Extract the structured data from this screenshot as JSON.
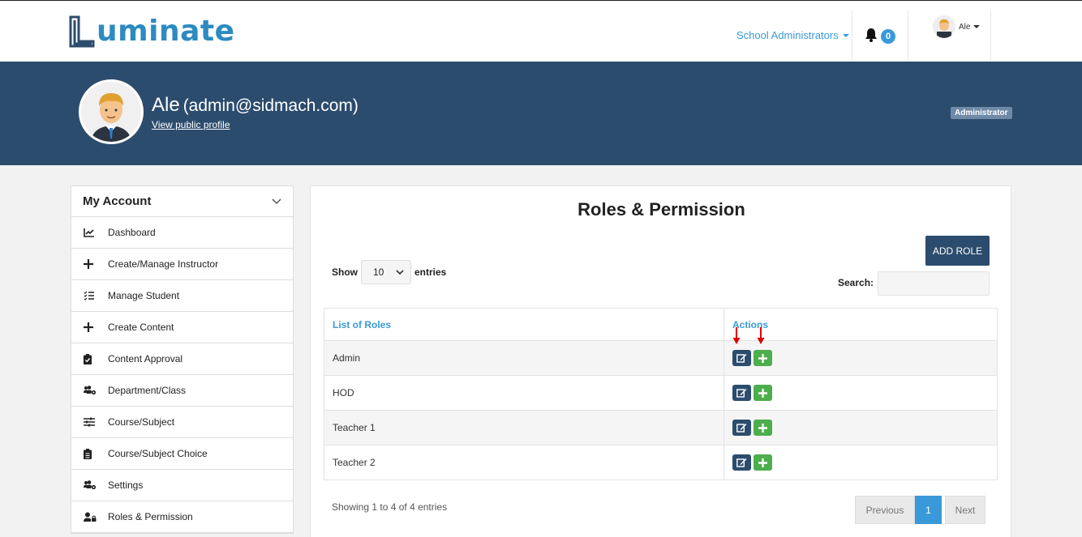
{
  "brand": {
    "logo_text": "uminate"
  },
  "topnav": {
    "role_label": "School Administrators",
    "notification_count": "0",
    "user_label": "Ale"
  },
  "profile": {
    "name": "Ale",
    "email": "(admin@sidmach.com)",
    "public_link": "View public profile",
    "role_badge": "Administrator"
  },
  "sidebar": {
    "heading": "My Account",
    "items": [
      {
        "label": "Dashboard",
        "icon": "chart-line-icon"
      },
      {
        "label": "Create/Manage Instructor",
        "icon": "plus-icon"
      },
      {
        "label": "Manage Student",
        "icon": "list-check-icon"
      },
      {
        "label": "Create Content",
        "icon": "plus-icon"
      },
      {
        "label": "Content Approval",
        "icon": "clipboard-check-icon"
      },
      {
        "label": "Department/Class",
        "icon": "users-cog-icon"
      },
      {
        "label": "Course/Subject",
        "icon": "sliders-icon"
      },
      {
        "label": "Course/Subject Choice",
        "icon": "clipboard-list-icon"
      },
      {
        "label": "Settings",
        "icon": "users-cog-icon"
      },
      {
        "label": "Roles & Permission",
        "icon": "user-lock-icon"
      }
    ]
  },
  "main": {
    "title": "Roles & Permission",
    "add_role_label": "ADD ROLE",
    "show_label": "Show",
    "entries_value": "10",
    "entries_label": "entries",
    "search_label": "Search:",
    "search_value": "",
    "columns": [
      "List of Roles",
      "Actions"
    ],
    "rows": [
      {
        "role": "Admin"
      },
      {
        "role": "HOD"
      },
      {
        "role": "Teacher 1"
      },
      {
        "role": "Teacher 2"
      }
    ],
    "info": "Showing 1 to 4 of 4 entries",
    "pagination": {
      "previous": "Previous",
      "current": "1",
      "next": "Next"
    }
  },
  "colors": {
    "primary_navy": "#2c4c6e",
    "link_blue": "#3a9ad9",
    "success_green": "#4cae4c",
    "annotation_red": "#e00000"
  }
}
